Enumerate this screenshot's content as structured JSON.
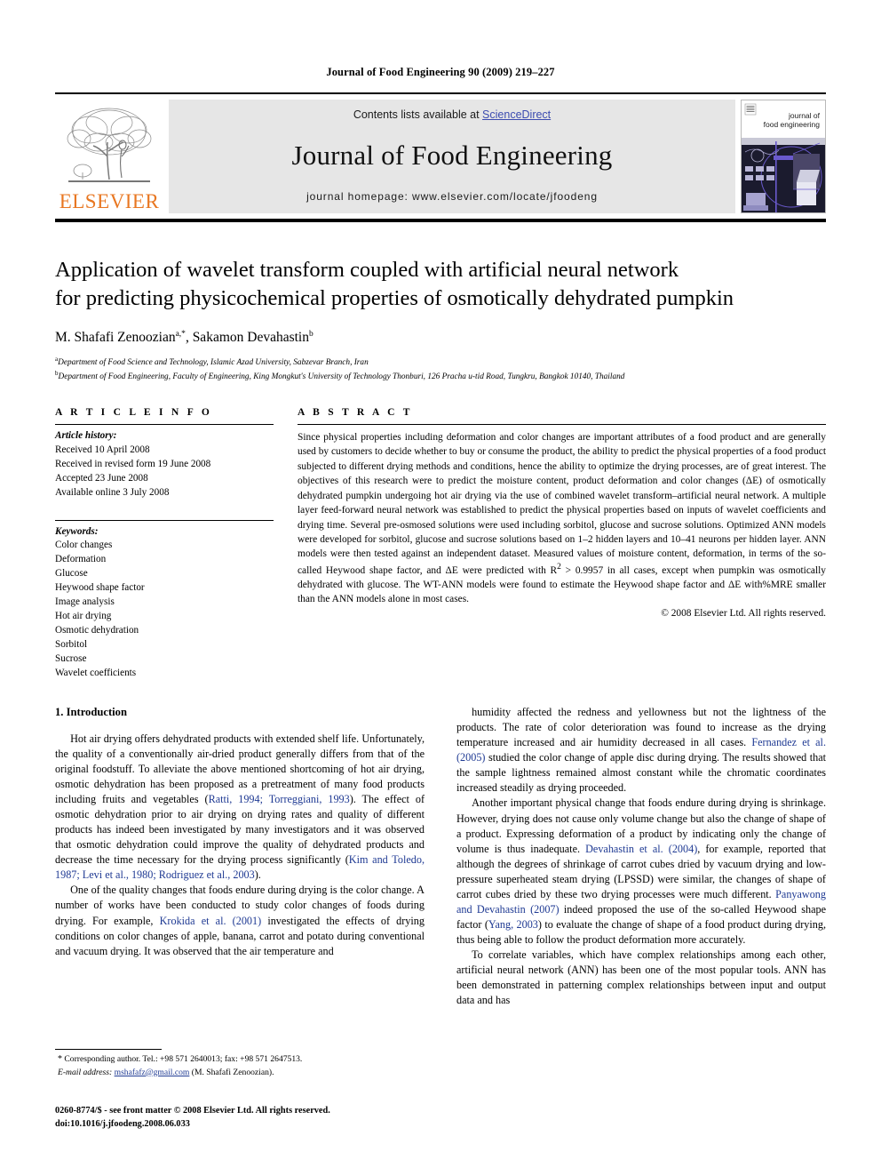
{
  "running_head": "Journal of Food Engineering 90 (2009) 219–227",
  "masthead": {
    "contents_prefix": "Contents lists available at ",
    "sciencedirect": "ScienceDirect",
    "journal_title": "Journal of Food Engineering",
    "homepage": "journal homepage: www.elsevier.com/locate/jfoodeng",
    "publisher": "ELSEVIER",
    "cover_title_line1": "journal of",
    "cover_title_line2": "food engineering",
    "colors": {
      "elsevier_orange": "#E87722",
      "link_blue": "#3b4bb0",
      "panel_gray": "#e6e6e6",
      "cover_purple": "#6a5acd"
    }
  },
  "article": {
    "title_line1": "Application of wavelet transform coupled with artificial neural network",
    "title_line2": "for predicting physicochemical properties of osmotically dehydrated pumpkin",
    "authors": "M. Shafafi Zenoozian , Sakamon Devahastin",
    "author1": "M. Shafafi Zenoozian",
    "author1_sup": "a,*",
    "author2": "Sakamon Devahastin",
    "author2_sup": "b",
    "affiliation_a_sup": "a",
    "affiliation_a": "Department of Food Science and Technology, Islamic Azad University, Sabzevar Branch, Iran",
    "affiliation_b_sup": "b",
    "affiliation_b": "Department of Food Engineering, Faculty of Engineering, King Mongkut's University of Technology Thonburi, 126 Pracha u-tid Road, Tungkru, Bangkok 10140, Thailand"
  },
  "article_info": {
    "heading": "A R T I C L E    I N F O",
    "history_label": "Article history:",
    "history": [
      "Received 10 April 2008",
      "Received in revised form 19 June 2008",
      "Accepted 23 June 2008",
      "Available online 3 July 2008"
    ],
    "keywords_label": "Keywords:",
    "keywords": [
      "Color changes",
      "Deformation",
      "Glucose",
      "Heywood shape factor",
      "Image analysis",
      "Hot air drying",
      "Osmotic dehydration",
      "Sorbitol",
      "Sucrose",
      "Wavelet coefficients"
    ]
  },
  "abstract": {
    "heading": "A B S T R A C T",
    "text": "Since physical properties including deformation and color changes are important attributes of a food product and are generally used by customers to decide whether to buy or consume the product, the ability to predict the physical properties of a food product subjected to different drying methods and conditions, hence the ability to optimize the drying processes, are of great interest. The objectives of this research were to predict the moisture content, product deformation and color changes (ΔE) of osmotically dehydrated pumpkin undergoing hot air drying via the use of combined wavelet transform–artificial neural network. A multiple layer feed-forward neural network was established to predict the physical properties based on inputs of wavelet coefficients and drying time. Several pre-osmosed solutions were used including sorbitol, glucose and sucrose solutions. Optimized ANN models were developed for sorbitol, glucose and sucrose solutions based on 1–2 hidden layers and 10–41 neurons per hidden layer. ANN models were then tested against an independent dataset. Measured values of moisture content, deformation, in terms of the so-called Heywood shape factor, and ΔE were predicted with R",
    "r_squared_sup": "2",
    "text_after_r2": " > 0.9957 in all cases, except when pumpkin was osmotically dehydrated with glucose. The WT-ANN models were found to estimate the Heywood shape factor and ΔE with%MRE smaller than the ANN models alone in most cases.",
    "copyright": "© 2008 Elsevier Ltd. All rights reserved."
  },
  "body": {
    "section_title": "1. Introduction",
    "left_paragraphs": [
      "Hot air drying offers dehydrated products with extended shelf life. Unfortunately, the quality of a conventionally air-dried product generally differs from that of the original foodstuff. To alleviate the above mentioned shortcoming of hot air drying, osmotic dehydration has been proposed as a pretreatment of many food products including fruits and vegetables (Ratti, 1994; Torreggiani, 1993). The effect of osmotic dehydration prior to air drying on drying rates and quality of different products has indeed been investigated by many investigators and it was observed that osmotic dehydration could improve the quality of dehydrated products and decrease the time necessary for the drying process significantly (Kim and Toledo, 1987; Levi et al., 1980; Rodriguez et al., 2003).",
      "One of the quality changes that foods endure during drying is the color change. A number of works have been conducted to study color changes of foods during drying. For example, Krokida et al. (2001) investigated the effects of drying conditions on color changes of apple, banana, carrot and potato during conventional and vacuum drying. It was observed that the air temperature and"
    ],
    "right_paragraphs": [
      "humidity affected the redness and yellowness but not the lightness of the products. The rate of color deterioration was found to increase as the drying temperature increased and air humidity decreased in all cases. Fernandez et al. (2005) studied the color change of apple disc during drying. The results showed that the sample lightness remained almost constant while the chromatic coordinates increased steadily as drying proceeded.",
      "Another important physical change that foods endure during drying is shrinkage. However, drying does not cause only volume change but also the change of shape of a product. Expressing deformation of a product by indicating only the change of volume is thus inadequate. Devahastin et al. (2004), for example, reported that although the degrees of shrinkage of carrot cubes dried by vacuum drying and low-pressure superheated steam drying (LPSSD) were similar, the changes of shape of carrot cubes dried by these two drying processes were much different. Panyawong and Devahastin (2007) indeed proposed the use of the so-called Heywood shape factor (Yang, 2003) to evaluate the change of shape of a food product during drying, thus being able to follow the product deformation more accurately.",
      "To correlate variables, which have complex relationships among each other, artificial neural network (ANN) has been one of the most popular tools. ANN has been demonstrated in patterning complex relationships between input and output data and has"
    ]
  },
  "footnotes": {
    "corresponding": "Corresponding author. Tel.: +98 571 2640013; fax: +98 571 2647513.",
    "email_label": "E-mail address:",
    "email": "mshafafz@gmail.com",
    "email_suffix": " (M. Shafafi Zenoozian).",
    "issn_line": "0260-8774/$ - see front matter © 2008 Elsevier Ltd. All rights reserved.",
    "doi_line": "doi:10.1016/j.jfoodeng.2008.06.033"
  }
}
